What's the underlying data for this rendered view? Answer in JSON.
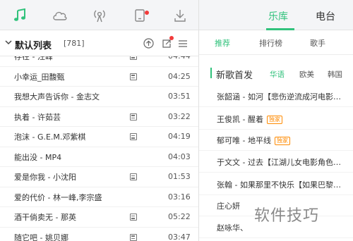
{
  "top_nav": {
    "icons": [
      "music-note-icon",
      "cloud-icon",
      "radio-icon",
      "device-icon",
      "download-icon"
    ],
    "accent": "#31c27c",
    "badge_color": "#f23b3b"
  },
  "playlist": {
    "title": "默认列表",
    "count": "[781]",
    "songs": [
      {
        "name": "存在 - 汪峰",
        "has_mv": true,
        "duration": "04:44"
      },
      {
        "name": "小幸运_田馥甄",
        "has_mv": true,
        "duration": "04:25"
      },
      {
        "name": "我想大声告诉你 - 金志文",
        "has_mv": false,
        "duration": "03:51"
      },
      {
        "name": "执着 - 许茹芸",
        "has_mv": true,
        "duration": "03:22"
      },
      {
        "name": "泡沫 - G.E.M.邓紫棋",
        "has_mv": true,
        "duration": "04:19"
      },
      {
        "name": "能出没 - MP4",
        "has_mv": false,
        "duration": "04:03"
      },
      {
        "name": "爱是你我 - 小沈阳",
        "has_mv": true,
        "duration": "01:53"
      },
      {
        "name": "爱的代价 - 林一峰,李宗盛",
        "has_mv": false,
        "duration": "03:16"
      },
      {
        "name": "酒干倘卖无 - 那英",
        "has_mv": true,
        "duration": "05:22"
      },
      {
        "name": "随它吧 - 姚贝娜",
        "has_mv": true,
        "duration": "03:47"
      }
    ]
  },
  "right": {
    "tabs": [
      {
        "label": "乐库",
        "active": true
      },
      {
        "label": "电台",
        "active": false
      }
    ],
    "subtabs": [
      {
        "label": "推荐",
        "active": true
      },
      {
        "label": "排行榜",
        "active": false
      },
      {
        "label": "歌手",
        "active": false
      }
    ],
    "section": {
      "title": "新歌首发",
      "langs": [
        {
          "label": "华语",
          "active": true
        },
        {
          "label": "欧美",
          "active": false
        },
        {
          "label": "韩国",
          "active": false
        }
      ]
    },
    "rows": [
      {
        "text": "张韶涵 - 如河【悲伤逆流成河电影…",
        "tag": ""
      },
      {
        "text": "王俊凯 - 醒着",
        "tag": "独家"
      },
      {
        "text": "郁可唯 - 地平线",
        "tag": "独家"
      },
      {
        "text": "于文文 - 过去【江湖儿女电影角色…",
        "tag": ""
      },
      {
        "text": "张翰 - 如果那里不快乐【如果巴黎…",
        "tag": ""
      },
      {
        "text": "庄心妍",
        "tag": ""
      },
      {
        "text": "赵咏华、",
        "tag": ""
      }
    ]
  },
  "watermark": "软件技巧"
}
